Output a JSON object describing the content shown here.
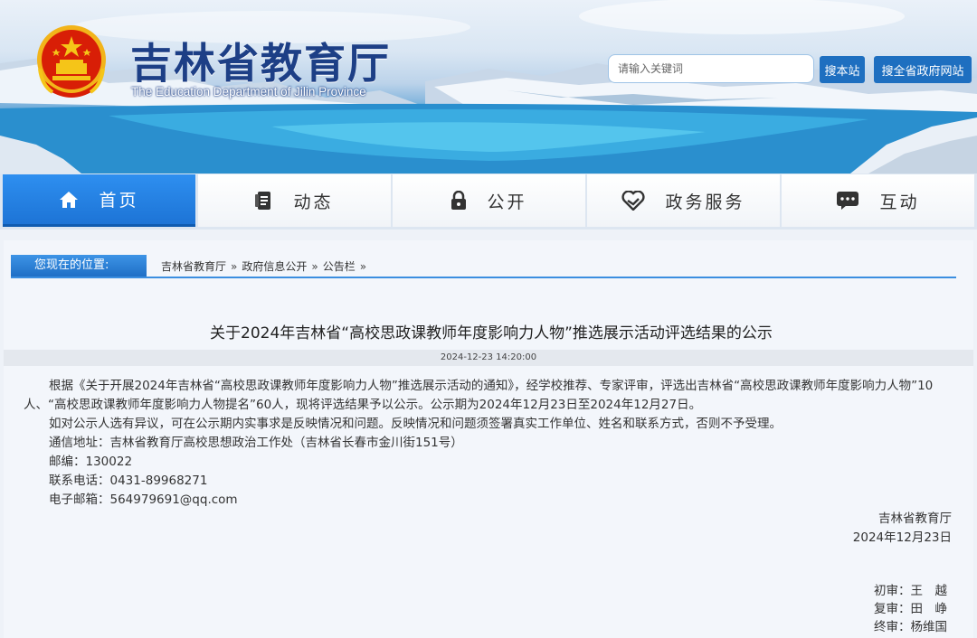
{
  "header": {
    "site_title": "吉林省教育厅",
    "site_subtitle": "The Education Department of Jilin Province",
    "search_placeholder": "请输入关键词",
    "search_site_button": "搜本站",
    "search_all_button": "搜全省政府网站"
  },
  "nav": {
    "items": [
      {
        "label": "首页",
        "icon": "home-icon",
        "active": true
      },
      {
        "label": "动态",
        "icon": "document-icon",
        "active": false
      },
      {
        "label": "公开",
        "icon": "lock-icon",
        "active": false
      },
      {
        "label": "政务服务",
        "icon": "heart-hands-icon",
        "active": false
      },
      {
        "label": "互动",
        "icon": "chat-icon",
        "active": false
      }
    ]
  },
  "breadcrumb": {
    "label": "您现在的位置:",
    "items": [
      "吉林省教育厅",
      "政府信息公开",
      "公告栏"
    ],
    "separator": "»"
  },
  "article": {
    "title": "关于2024年吉林省“高校思政课教师年度影响力人物”推选展示活动评选结果的公示",
    "datetime": "2024-12-23 14:20:00",
    "paragraph_1": "根据《关于开展2024年吉林省“高校思政课教师年度影响力人物”推选展示活动的通知》，经学校推荐、专家评审，评选出吉林省“高校思政课教师年度影响力人物”10人、“高校思政课教师年度影响力人物提名”60人，现将评选结果予以公示。公示期为2024年12月23日至2024年12月27日。",
    "paragraph_2": "如对公示人选有异议，可在公示期内实事求是反映情况和问题。反映情况和问题须签署真实工作单位、姓名和联系方式，否则不予受理。",
    "address": "通信地址：吉林省教育厅高校思想政治工作处（吉林省长春市金川街151号）",
    "postcode": "邮编：130022",
    "phone": "联系电话：0431-89968271",
    "email": "电子邮箱：564979691@qq.com",
    "signature_org": "吉林省教育厅",
    "signature_date": "2024年12月23日",
    "review_1": "初审：王　越",
    "review_2": "复审：田　峥",
    "review_3": "终审：杨维国"
  },
  "colors": {
    "brand_blue": "#1e6fc0",
    "title_blue": "#1d3f86",
    "nav_active": "#2480e0",
    "emblem_red": "#d81e06",
    "emblem_gold": "#f5c518"
  }
}
